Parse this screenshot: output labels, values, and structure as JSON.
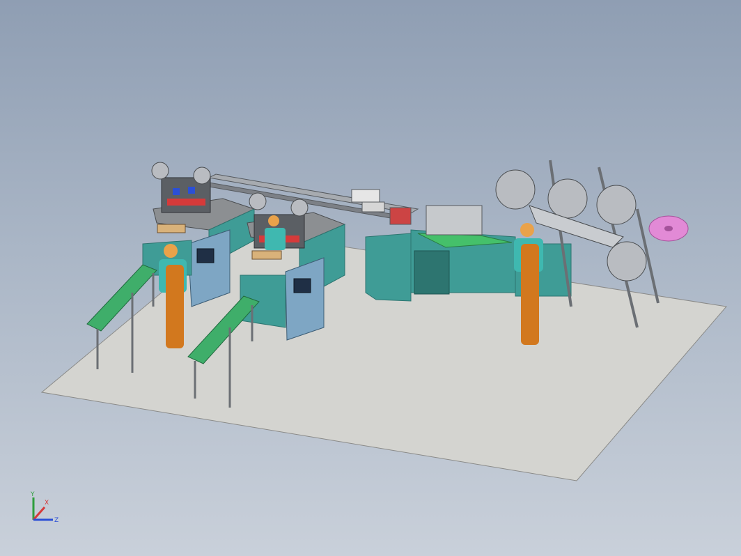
{
  "viewport": {
    "background_top": "#8f9eb3",
    "background_bottom": "#c9d0da"
  },
  "colors": {
    "floor": "#d4d4d0",
    "floor_edge": "#8a8a88",
    "cabinet_teal": "#3f9c96",
    "cabinet_teal_dark": "#2d7570",
    "cabinet_blue": "#7ea6c4",
    "conveyor_green": "#3fae6a",
    "plate_green": "#45c06a",
    "frame_gray": "#6b6f74",
    "roll_gray": "#b9bcc1",
    "roll_pink": "#e28ad6",
    "worker_skin": "#e9a24a",
    "worker_shirt": "#3fb8b0",
    "worker_pants": "#d2781e",
    "accent_red": "#d63a3a"
  },
  "scene": {
    "objects": [
      "floor-plate",
      "ear-loop-welder-station-1",
      "ear-loop-welder-station-2",
      "transfer-conveyor",
      "mask-body-forming-machine",
      "nonwoven-fabric-rolls",
      "nose-wire-reel",
      "output-conveyor-1",
      "output-conveyor-2",
      "operator-1",
      "operator-2",
      "operator-3"
    ]
  },
  "triad": {
    "x_label": "X",
    "y_label": "Y",
    "z_label": "Z",
    "x_color": "#d63a3a",
    "y_color": "#2e9e3e",
    "z_color": "#2b4fd6"
  }
}
